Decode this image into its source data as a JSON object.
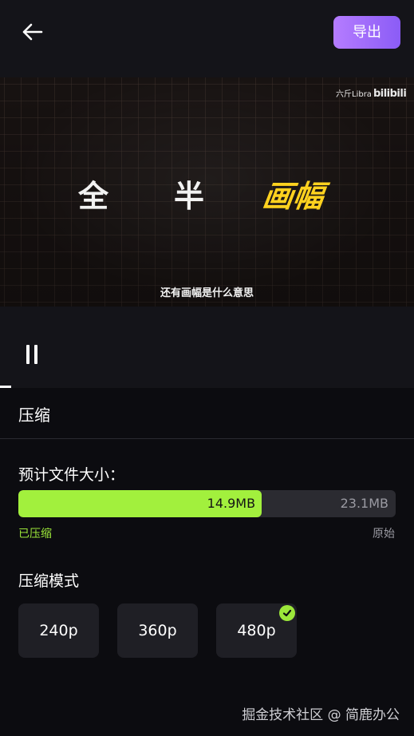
{
  "header": {
    "back_icon": "arrow-left-icon",
    "export_label": "导出",
    "export_gradient": [
      "#b57cff",
      "#8b5cf6"
    ]
  },
  "video": {
    "watermark_text": "六斤Libra",
    "watermark_logo": "bilibili",
    "title_chars": [
      "全",
      "半",
      "画幅"
    ],
    "title_highlight_color": "#ffd21f",
    "subtitle": "还有画幅是什么意思"
  },
  "player": {
    "pause_icon": "pause-icon",
    "progress": 0.027
  },
  "compress": {
    "section_title": "压缩",
    "estimate_label": "预计文件大小：",
    "compressed_size": "14.9MB",
    "original_size": "23.1MB",
    "compressed_ratio": 0.645,
    "compressed_caption": "已压缩",
    "original_caption": "原始",
    "accent_color": "#a2f03d",
    "mode_title": "压缩模式",
    "modes": [
      {
        "label": "240p",
        "selected": false
      },
      {
        "label": "360p",
        "selected": false
      },
      {
        "label": "480p",
        "selected": true
      }
    ],
    "selected_icon": "check-icon"
  },
  "footer": {
    "watermark": "掘金技术社区 @ 简鹿办公"
  }
}
